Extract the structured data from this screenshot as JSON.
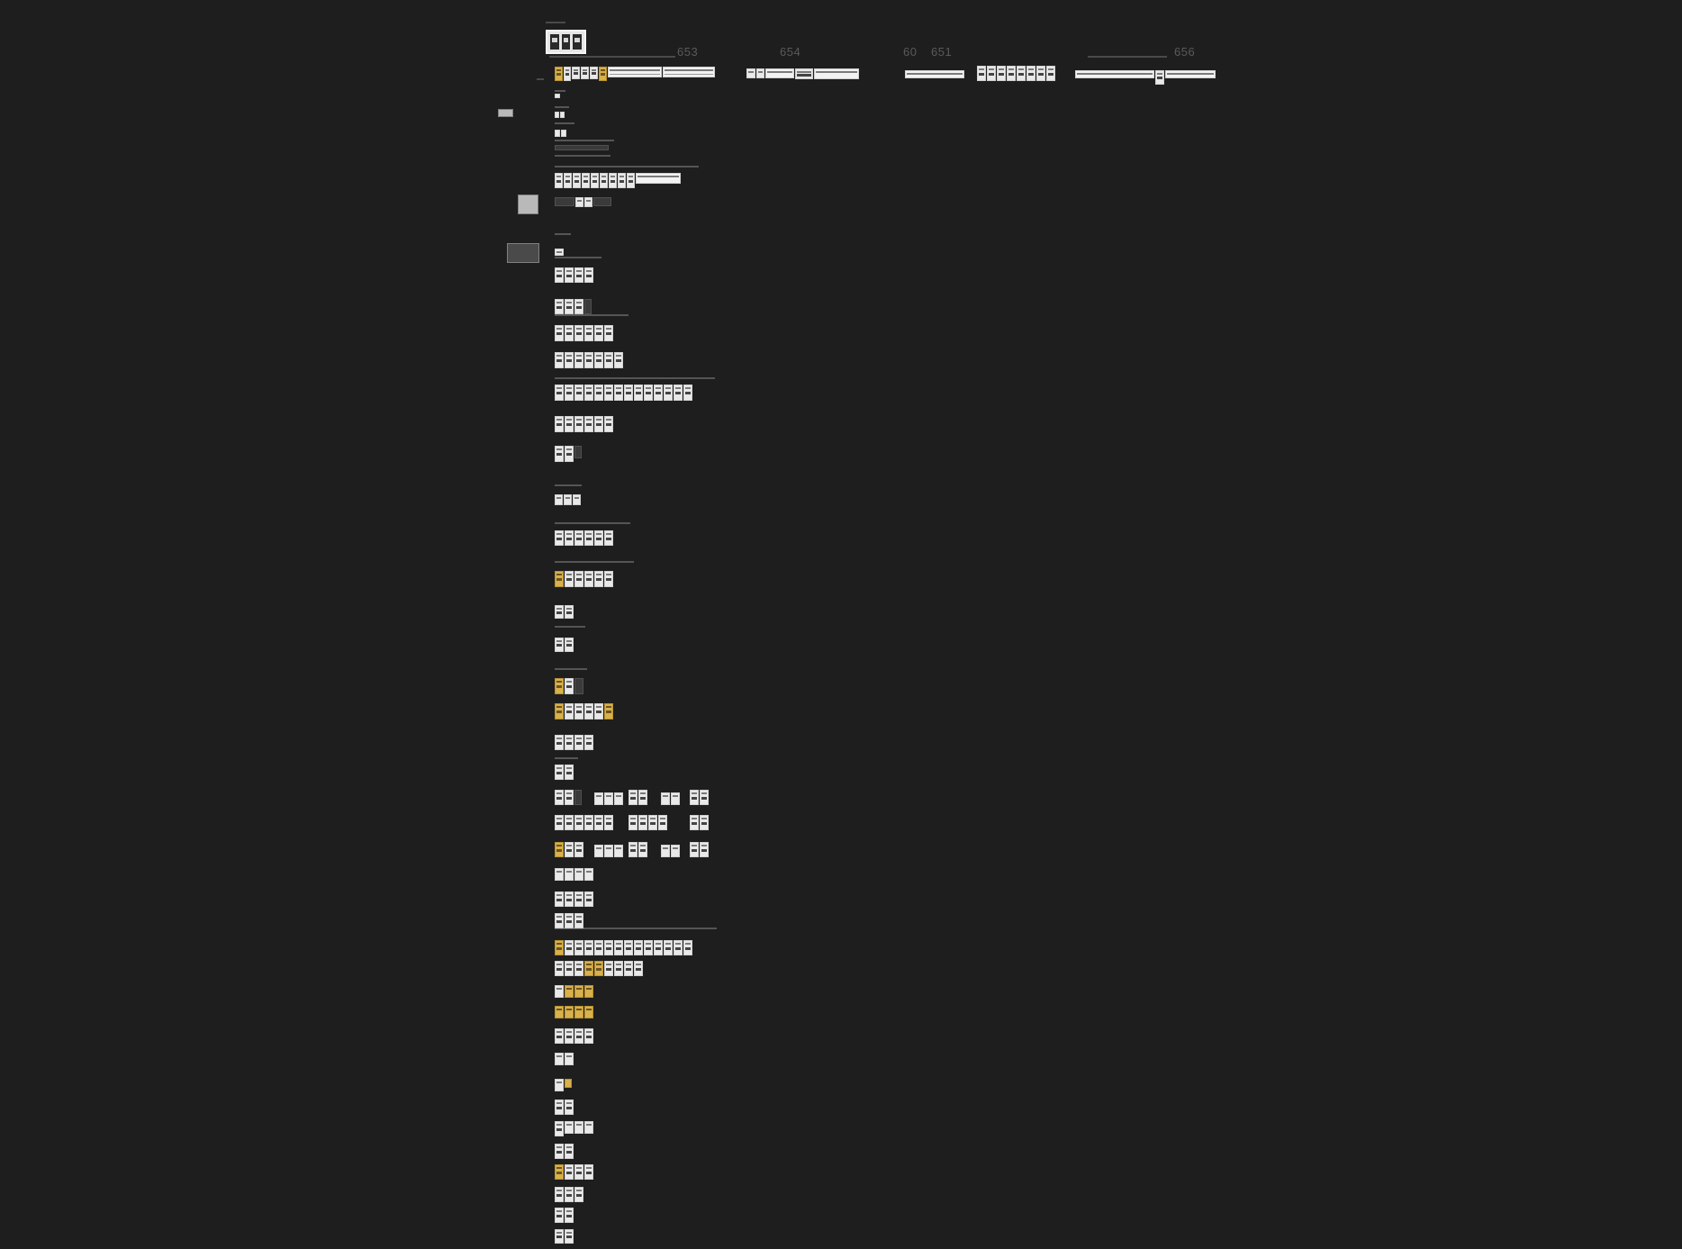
{
  "canvas": {
    "background": "#1e1e1e",
    "accent_color": "#d8b04c",
    "frame_color": "#e9e9e9"
  },
  "section_labels": [
    "653",
    "654",
    "60",
    "651",
    "656"
  ]
}
